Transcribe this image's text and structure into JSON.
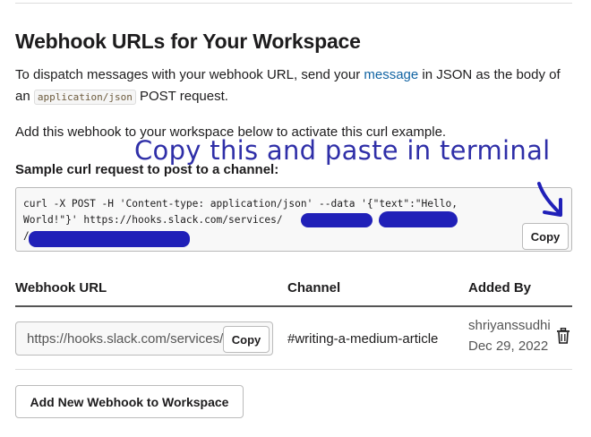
{
  "heading": "Webhook URLs for Your Workspace",
  "intro": {
    "part1": "To dispatch messages with your webhook URL, send your ",
    "link": "message",
    "part2": " in JSON as the body of an ",
    "code": "application/json",
    "part3": " POST request."
  },
  "add_note": "Add this webhook to your workspace below to activate this curl example.",
  "sample_label": "Sample curl request to post to a channel:",
  "annotation": "Copy this and paste in terminal",
  "code_box": {
    "line1": "curl -X POST -H 'Content-type: application/json' --data '{\"text\":\"Hello,",
    "line2": "World!\"}' https://hooks.slack.com/services/",
    "line3": "/",
    "copy_label": "Copy"
  },
  "table": {
    "col_url": "Webhook URL",
    "col_channel": "Channel",
    "col_added": "Added By",
    "row": {
      "url": "https://hooks.slack.com/services/",
      "copy_label": "Copy",
      "channel": "#writing-a-medium-article",
      "added_by": "shriyanssudhi",
      "date": "Dec 29, 2022"
    }
  },
  "add_button": "Add New Webhook to Workspace",
  "colors": {
    "link": "#1264a3",
    "annotation_ink": "#2f2fa8",
    "redaction": "#2020b8"
  },
  "icons": [
    "arrow-annotation-icon",
    "trash-icon"
  ]
}
